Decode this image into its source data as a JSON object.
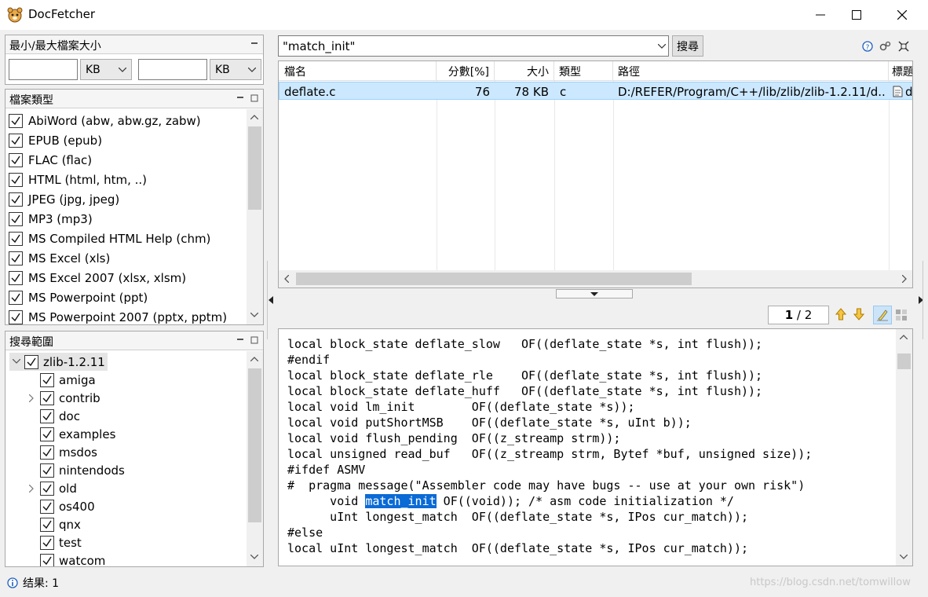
{
  "window": {
    "title": "DocFetcher"
  },
  "size_filter": {
    "title": "最小/最大檔案大小",
    "min_value": "",
    "min_unit": "KB",
    "max_value": "",
    "max_unit": "KB"
  },
  "file_types": {
    "title": "檔案類型",
    "items": [
      "AbiWord (abw, abw.gz, zabw)",
      "EPUB (epub)",
      "FLAC (flac)",
      "HTML (html, htm, ..)",
      "JPEG (jpg, jpeg)",
      "MP3 (mp3)",
      "MS Compiled HTML Help (chm)",
      "MS Excel (xls)",
      "MS Excel 2007 (xlsx, xlsm)",
      "MS Powerpoint (ppt)",
      "MS Powerpoint 2007 (pptx, pptm)"
    ]
  },
  "search_scope": {
    "title": "搜尋範圍",
    "root": "zlib-1.2.11",
    "children": [
      "amiga",
      "contrib",
      "doc",
      "examples",
      "msdos",
      "nintendods",
      "old",
      "os400",
      "qnx",
      "test",
      "watcom"
    ]
  },
  "search": {
    "query": "\"match_init\"",
    "button": "搜尋"
  },
  "results": {
    "columns": [
      "檔名",
      "分數[%]",
      "大小",
      "類型",
      "路徑",
      "標題"
    ],
    "rows": [
      {
        "name": "deflate.c",
        "score": "76",
        "size": "78 KB",
        "type": "c",
        "path": "D:/REFER/Program/C++/lib/zlib/zlib-1.2.11/d...",
        "title": "d"
      }
    ]
  },
  "preview": {
    "page_current": "1",
    "page_sep": " / ",
    "page_total": "2",
    "code_lines": [
      "local block_state deflate_slow   OF((deflate_state *s, int flush));",
      "#endif",
      "local block_state deflate_rle    OF((deflate_state *s, int flush));",
      "local block_state deflate_huff   OF((deflate_state *s, int flush));",
      "local void lm_init        OF((deflate_state *s));",
      "local void putShortMSB    OF((deflate_state *s, uInt b));",
      "local void flush_pending  OF((z_streamp strm));",
      "local unsigned read_buf   OF((z_streamp strm, Bytef *buf, unsigned size));",
      "#ifdef ASMV",
      "#  pragma message(\"Assembler code may have bugs -- use at your own risk\")",
      "      void ",
      "match_init",
      " OF((void)); /* asm code initialization */",
      "      uInt longest_match  OF((deflate_state *s, IPos cur_match));",
      "#else",
      "local uInt longest_match  OF((deflate_state *s, IPos cur_match));"
    ]
  },
  "status": {
    "text": "结果: 1"
  },
  "watermark": "https://blog.csdn.net/tomwillow"
}
